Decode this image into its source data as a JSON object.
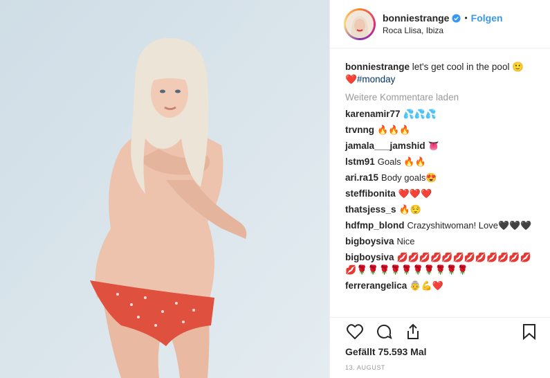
{
  "header": {
    "username": "bonniestrange",
    "separator": "•",
    "follow_label": "Folgen",
    "location": "Roca Llisa, Ibiza"
  },
  "caption": {
    "username": "bonniestrange",
    "text": "let's get cool in the pool 🙂",
    "heart": "❤️",
    "hashtag": "#monday"
  },
  "load_more": "Weitere Kommentare laden",
  "comments": [
    {
      "user": "karenamir77",
      "text": "💦💦💦"
    },
    {
      "user": "trvnng",
      "text": "🔥🔥🔥"
    },
    {
      "user": "jamala___jamshid",
      "text": "👅"
    },
    {
      "user": "lstm91",
      "text": "Goals 🔥🔥"
    },
    {
      "user": "ari.ra15",
      "text": "Body goals😍"
    },
    {
      "user": "steffibonita",
      "text": "❤️❤️❤️"
    },
    {
      "user": "thatsjess_s",
      "text": "🔥😌"
    },
    {
      "user": "hdfmp_blond",
      "text": "Crazyshitwoman! Love🖤🖤🖤"
    },
    {
      "user": "bigboysiva",
      "text": "Nice"
    },
    {
      "user": "bigboysiva",
      "text": "💋💋💋💋💋💋💋💋💋💋💋💋💋🌹🌹🌹🌹🌹🌹🌹🌹🌹🌹"
    },
    {
      "user": "ferrerangelica",
      "text": "👵💪❤️"
    }
  ],
  "likes": "Gefällt 75.593 Mal",
  "date": "13. AUGUST",
  "colors": {
    "accent": "#3897f0",
    "text": "#262626",
    "muted": "#999999"
  },
  "icons": [
    "verified-badge-icon",
    "heart-icon",
    "comment-icon",
    "share-icon",
    "bookmark-icon"
  ]
}
